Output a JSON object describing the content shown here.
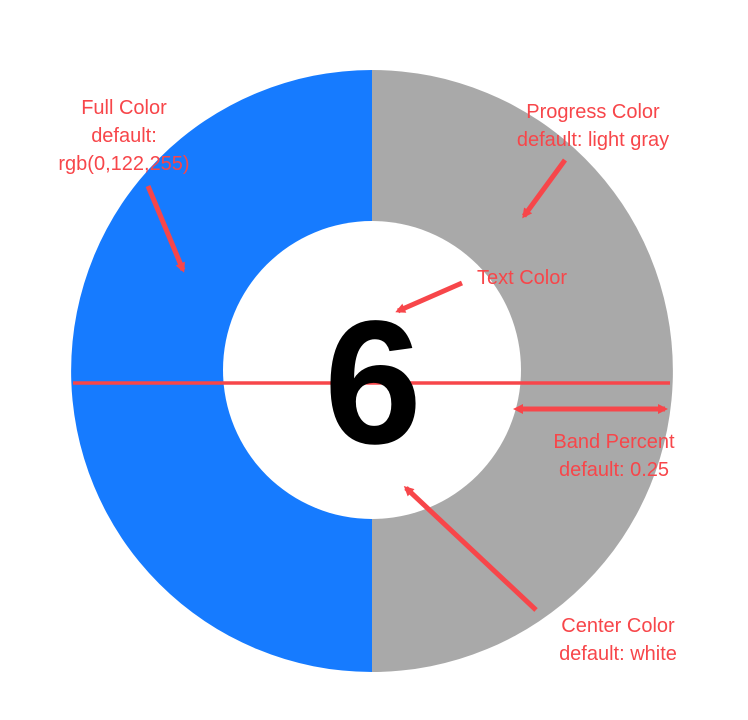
{
  "ring": {
    "value": "6",
    "progress_fraction": 0.5,
    "band_percent": 0.25,
    "colors": {
      "full": "#167bff",
      "progress": "#a9a9a9",
      "center": "#ffffff",
      "text": "#000000",
      "annotation": "#f7464a"
    }
  },
  "annotations": {
    "full_color": {
      "line1": "Full Color",
      "line2": "default:",
      "line3": "rgb(0,122,255)"
    },
    "progress_color": {
      "line1": "Progress Color",
      "line2": "default: light gray"
    },
    "text_color": {
      "line1": "Text Color"
    },
    "band_percent": {
      "line1": "Band Percent",
      "line2": "default: 0.25"
    },
    "center_color": {
      "line1": "Center Color",
      "line2": "default: white"
    }
  }
}
